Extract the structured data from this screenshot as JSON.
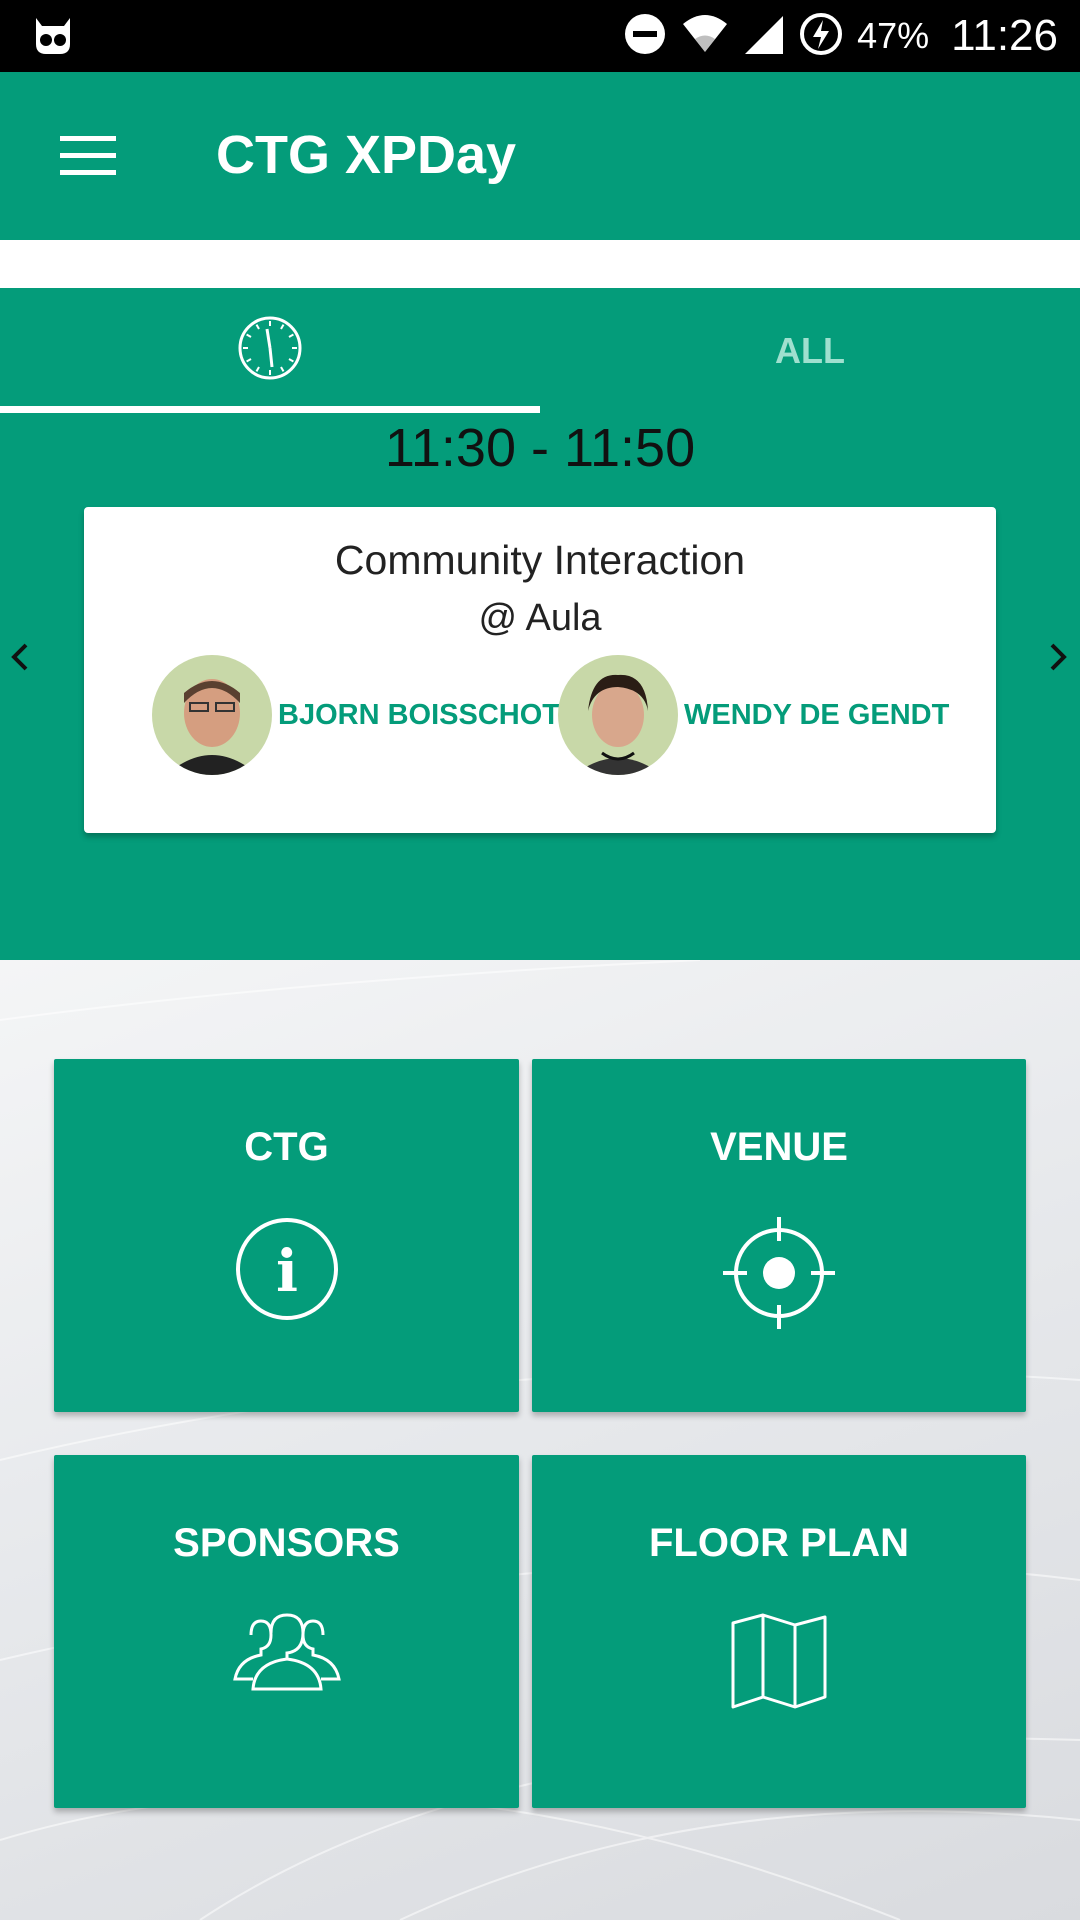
{
  "status_bar": {
    "battery": "47%",
    "clock": "11:26",
    "icons": [
      "app-notification-icon",
      "do-not-disturb-icon",
      "wifi-icon",
      "cell-signal-icon",
      "battery-charging-icon"
    ]
  },
  "app_bar": {
    "title": "CTG XPDay",
    "menu_icon": "hamburger-menu-icon"
  },
  "tabs": {
    "now_icon": "clock-icon",
    "all_label": "ALL",
    "selected": "now"
  },
  "now": {
    "time_slot": "11:30 - 11:50",
    "session": {
      "title": "Community Interaction",
      "room": "@ Aula",
      "speakers": [
        {
          "name": "BJORN BOISSCHOT"
        },
        {
          "name": "WENDY DE GENDT"
        }
      ]
    }
  },
  "tiles": [
    {
      "label": "CTG",
      "icon": "info-icon"
    },
    {
      "label": "VENUE",
      "icon": "location-target-icon"
    },
    {
      "label": "SPONSORS",
      "icon": "people-group-icon"
    },
    {
      "label": "FLOOR PLAN",
      "icon": "map-icon"
    }
  ],
  "colors": {
    "primary": "#049c7a",
    "status_bar": "#000000",
    "card": "#ffffff",
    "tab_inactive_text": "#9fe0cf"
  }
}
